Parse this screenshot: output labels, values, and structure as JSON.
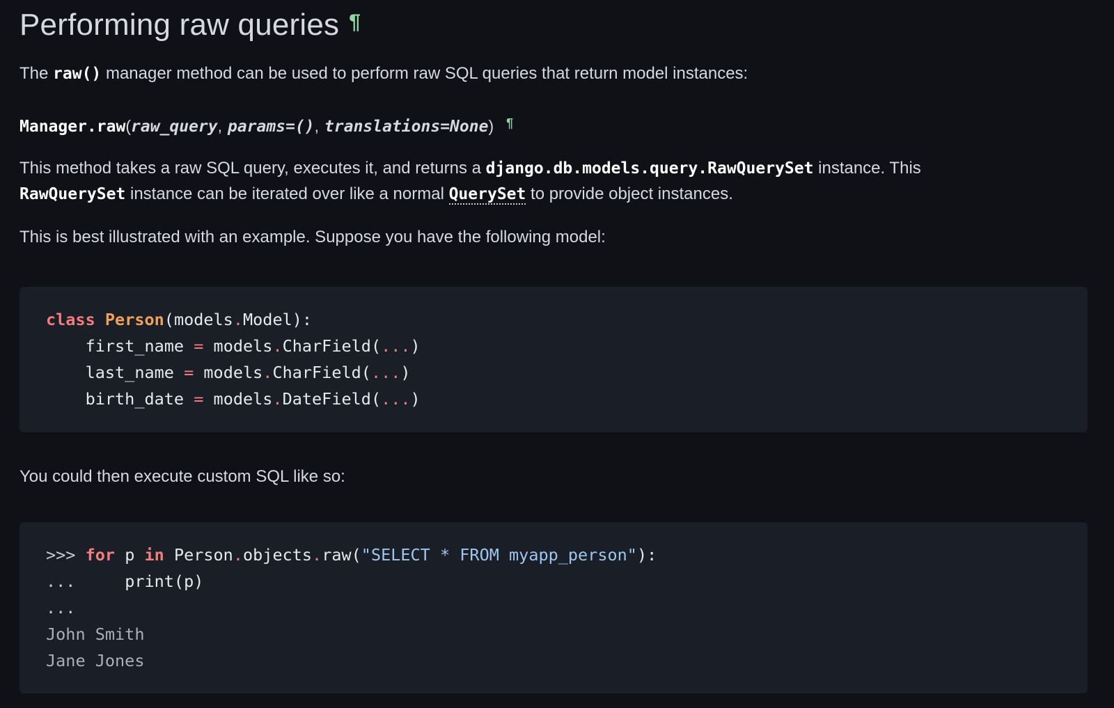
{
  "heading": {
    "text": "Performing raw queries",
    "pilcrow": "¶"
  },
  "intro": {
    "before": "The ",
    "code": "raw()",
    "after": " manager method can be used to perform raw SQL queries that return model instances:"
  },
  "signature": {
    "name": "Manager.raw",
    "open": "(",
    "args": [
      "raw_query",
      "params=()",
      "translations=None"
    ],
    "close": ")",
    "pilcrow": "¶"
  },
  "desc": {
    "line1_before": "This method takes a raw SQL query, executes it, and returns a ",
    "line1_code": "django.db.models.query.RawQuerySet",
    "line1_after": " instance. This",
    "line2_code": "RawQuerySet",
    "line2_middle": " instance can be iterated over like a normal ",
    "line2_link": "QuerySet",
    "line2_after": " to provide object instances."
  },
  "example_intro": "This is best illustrated with an example. Suppose you have the following model:",
  "model_code": {
    "kw_class": "class",
    "class_name": "Person",
    "base_open": "(models",
    "base_dot": ".",
    "base_rest": "Model):",
    "fields": [
      {
        "indent": "    ",
        "name": "first_name",
        "eq": "=",
        "module": "models",
        "dot": ".",
        "type": "CharField",
        "args_open": "(",
        "ellipsis": "...",
        "args_close": ")"
      },
      {
        "indent": "    ",
        "name": "last_name",
        "eq": "=",
        "module": "models",
        "dot": ".",
        "type": "CharField",
        "args_open": "(",
        "ellipsis": "...",
        "args_close": ")"
      },
      {
        "indent": "    ",
        "name": "birth_date",
        "eq": "=",
        "module": "models",
        "dot": ".",
        "type": "DateField",
        "args_open": "(",
        "ellipsis": "...",
        "args_close": ")"
      }
    ]
  },
  "custom_sql_intro": "You could then execute custom SQL like so:",
  "sql_code": {
    "prompt1": ">>> ",
    "kw_for": "for",
    "var": " p ",
    "kw_in": "in",
    "obj": " Person",
    "dot1": ".",
    "objects": "objects",
    "dot2": ".",
    "raw_open": "raw(",
    "query": "\"SELECT * FROM myapp_person\"",
    "raw_close": "):",
    "prompt2": "...",
    "body": "     print(p)",
    "prompt3": "...",
    "output": [
      "John Smith",
      "Jane Jones"
    ]
  }
}
